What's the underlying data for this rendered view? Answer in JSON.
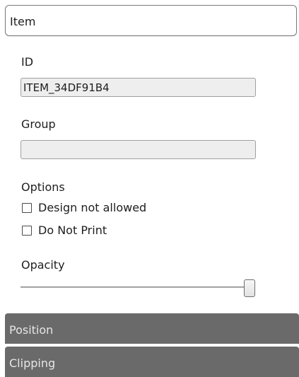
{
  "header": {
    "title": "Item"
  },
  "id_field": {
    "label": "ID",
    "value": "ITEM_34DF91B4",
    "placeholder": ""
  },
  "group_field": {
    "label": "Group",
    "value": "",
    "placeholder": ""
  },
  "options": {
    "label": "Options",
    "items": [
      {
        "label": "Design not allowed",
        "checked": false
      },
      {
        "label": "Do Not Print",
        "checked": false
      }
    ]
  },
  "opacity": {
    "label": "Opacity",
    "value": 1.0
  },
  "sections": [
    {
      "label": "Position"
    },
    {
      "label": "Clipping"
    }
  ],
  "colors": {
    "section_bar": "#6a6a6a",
    "field_background": "#eeeeee",
    "field_border": "#a0a0a0"
  }
}
